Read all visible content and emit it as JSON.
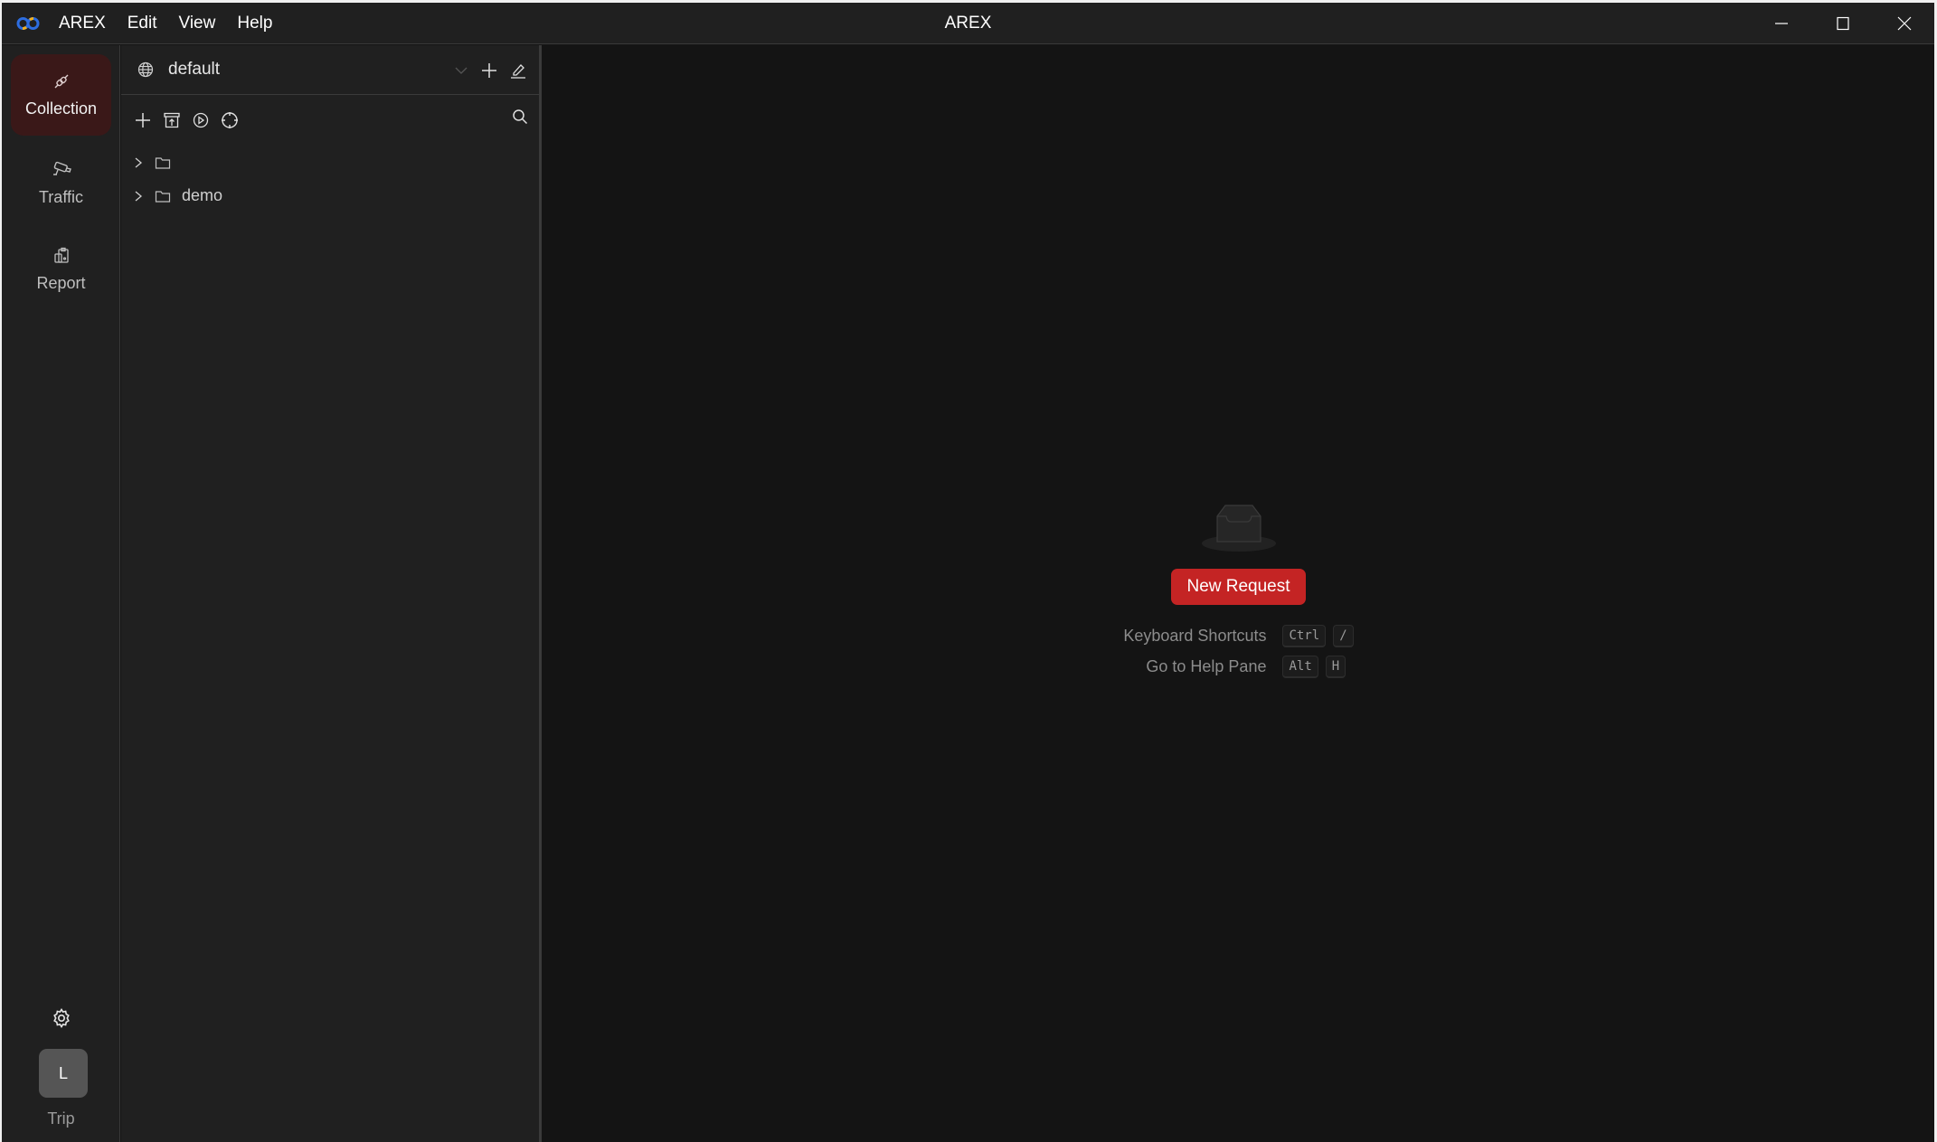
{
  "app": {
    "title": "AREX",
    "menu": [
      "AREX",
      "Edit",
      "View",
      "Help"
    ],
    "logo_icon": "arex-logo-icon",
    "window_controls": [
      "minimize-icon",
      "maximize-icon",
      "close-icon"
    ]
  },
  "activity_bar": {
    "items": [
      {
        "label": "Collection",
        "icon": "plug-icon",
        "active": true
      },
      {
        "label": "Traffic",
        "icon": "camera-icon",
        "active": false
      },
      {
        "label": "Report",
        "icon": "report-icon",
        "active": false
      }
    ],
    "settings_icon": "gear-icon",
    "user": {
      "avatar_initial": "L",
      "name": "Trip"
    }
  },
  "collection_panel": {
    "workspace": {
      "name": "default",
      "icon": "globe-icon"
    },
    "toolbar": [
      "add-icon",
      "import-icon",
      "run-icon",
      "target-icon"
    ],
    "tree": [
      {
        "label": "",
        "icon": "folder-icon",
        "expanded": false
      },
      {
        "label": "demo",
        "icon": "folder-icon",
        "expanded": false
      }
    ]
  },
  "main": {
    "empty_icon": "inbox-icon",
    "new_request_label": "New Request",
    "shortcuts": [
      {
        "label": "Keyboard Shortcuts",
        "keys": [
          "Ctrl",
          "/"
        ]
      },
      {
        "label": "Go to Help Pane",
        "keys": [
          "Alt",
          "H"
        ]
      }
    ]
  },
  "colors": {
    "accent": "#c42424",
    "active_tab_bg": "#3a1818",
    "panel_bg": "#202020",
    "main_bg": "#141414"
  }
}
